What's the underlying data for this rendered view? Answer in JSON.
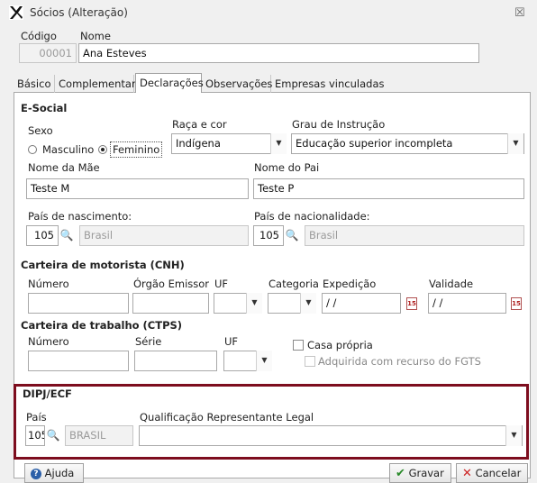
{
  "window": {
    "title": "Sócios (Alteração)",
    "close_glyph": "☒"
  },
  "header": {
    "codigo_label": "Código",
    "codigo_value": "00001",
    "nome_label": "Nome",
    "nome_value": "Ana Esteves"
  },
  "tabs": [
    {
      "label": "Básico"
    },
    {
      "label": "Complementar"
    },
    {
      "label": "Declarações"
    },
    {
      "label": "Observações"
    },
    {
      "label": "Empresas vinculadas"
    }
  ],
  "esocial": {
    "section_title": "E-Social",
    "sexo_label": "Sexo",
    "sexo_options": [
      "Masculino",
      "Feminino"
    ],
    "sexo_selected": "Feminino",
    "raca_label": "Raça e cor",
    "raca_value": "Indígena",
    "grau_label": "Grau de Instrução",
    "grau_value": "Educação superior incompleta",
    "mae_label": "Nome da Mãe",
    "mae_value": "Teste M",
    "pai_label": "Nome do Pai",
    "pai_value": "Teste P",
    "pais_nasc_label": "País de nascimento:",
    "pais_nasc_code": "105",
    "pais_nasc_name": "Brasil",
    "pais_nac_label": "País de nacionalidade:",
    "pais_nac_code": "105",
    "pais_nac_name": "Brasil"
  },
  "cnh": {
    "section_title": "Carteira de motorista (CNH)",
    "numero_label": "Número",
    "orgao_label": "Órgão Emissor",
    "uf_label": "UF",
    "categoria_label": "Categoria",
    "expedicao_label": "Expedição",
    "expedicao_value": "/ /",
    "validade_label": "Validade",
    "validade_value": "/ /",
    "calendar_glyph": "15"
  },
  "ctps": {
    "section_title": "Carteira de trabalho (CTPS)",
    "numero_label": "Número",
    "serie_label": "Série",
    "uf_label": "UF",
    "casa_propria_label": "Casa própria",
    "fgts_label": "Adquirida com recurso do FGTS"
  },
  "dipj": {
    "section_title": "DIPJ/ECF",
    "pais_label": "País",
    "pais_code": "105",
    "pais_name": "BRASIL",
    "qualificacao_label": "Qualificação Representante Legal",
    "qualificacao_value": ""
  },
  "buttons": {
    "ajuda": "Ajuda",
    "gravar": "Gravar",
    "cancelar": "Cancelar"
  },
  "colors": {
    "highlight_border": "#7d0d1e",
    "gravar_icon": "#2a8a2a",
    "cancelar_icon": "#cc2222",
    "help_icon": "#2b5fa8"
  }
}
